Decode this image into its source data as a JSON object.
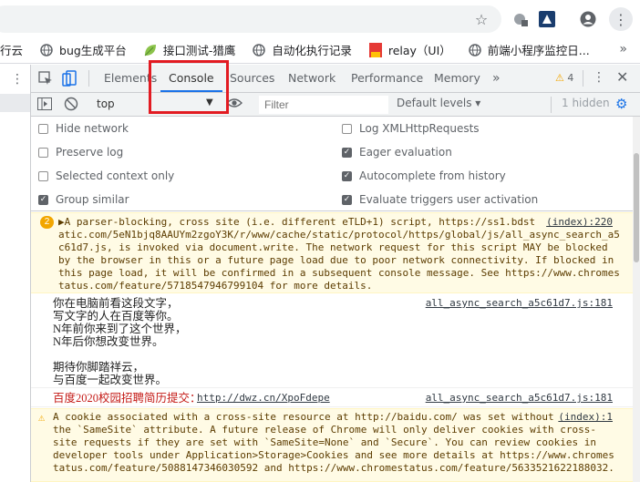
{
  "browser": {
    "icons": [
      "star-icon",
      "extension-icon",
      "profile-icon",
      "menu-icon"
    ]
  },
  "bookmarks": [
    {
      "label": "行云",
      "icon": "globe-icon",
      "color": "#5f6368"
    },
    {
      "label": "bug生成平台",
      "icon": "globe-icon",
      "color": "#5f6368"
    },
    {
      "label": "接口测试-猎鹰",
      "icon": "leaf-icon",
      "color": "#8bc34a"
    },
    {
      "label": "自动化执行记录",
      "icon": "globe-icon",
      "color": "#5f6368"
    },
    {
      "label": "relay（UI）",
      "icon": "bookmark-icon",
      "color": "#e53935"
    },
    {
      "label": "前端小程序监控日...",
      "icon": "globe-icon",
      "color": "#5f6368"
    }
  ],
  "devtools": {
    "tabs": [
      "Elements",
      "Console",
      "Sources",
      "Network",
      "Performance",
      "Memory"
    ],
    "active_tab": "Console",
    "more_tabs": "»",
    "warning_count": "4"
  },
  "console_toolbar": {
    "context": "top",
    "filter_placeholder": "Filter",
    "levels": "Default levels ▾",
    "hidden": "1 hidden"
  },
  "settings": {
    "left": [
      {
        "label": "Hide network",
        "checked": false
      },
      {
        "label": "Preserve log",
        "checked": false
      },
      {
        "label": "Selected context only",
        "checked": false
      },
      {
        "label": "Group similar",
        "checked": true
      }
    ],
    "right": [
      {
        "label": "Log XMLHttpRequests",
        "checked": false
      },
      {
        "label": "Eager evaluation",
        "checked": true
      },
      {
        "label": "Autocomplete from history",
        "checked": true
      },
      {
        "label": "Evaluate triggers user activation",
        "checked": true
      }
    ]
  },
  "messages": {
    "m1": {
      "count": "2",
      "source": "(index):220",
      "lines": [
        "▶A parser-blocking, cross site (i.e. different eTLD+1) script, https://ss1.bdst",
        "atic.com/5eN1bjq8AAUYm2zgoY3K/r/www/cache/static/protocol/https/global/js/all_async_search_a5",
        "c61d7.js, is invoked via document.write. The network request for this script MAY be blocked",
        "by the browser in this or a future page load due to poor network connectivity. If blocked in",
        "this page load, it will be confirmed in a subsequent console message. See https://www.chromes",
        "tatus.com/feature/5718547946799104 for more details."
      ]
    },
    "m2": {
      "source": "all_async_search_a5c61d7.js:181",
      "lines": [
        "你在电脑前看这段文字，",
        "写文字的人在百度等你。",
        "N年前你来到了这个世界，",
        "N年后你想改变世界。",
        "",
        "期待你脚踏祥云，",
        "与百度一起改变世界。"
      ]
    },
    "m3": {
      "text": "百度2020校园招聘简历提交：",
      "link": "http://dwz.cn/XpoFdepe",
      "source": "all_async_search_a5c61d7.js:181"
    },
    "m4": {
      "source": "(index):1",
      "lines": [
        "A cookie associated with a cross-site resource at http://baidu.com/ was set without",
        "the `SameSite` attribute. A future release of Chrome will only deliver cookies with cross-",
        "site requests if they are set with `SameSite=None` and `Secure`. You can review cookies in",
        "developer tools under Application>Storage>Cookies and see more details at https://www.chromes",
        "tatus.com/feature/5088147346030592 and https://www.chromestatus.com/feature/5633521622188032."
      ]
    }
  }
}
